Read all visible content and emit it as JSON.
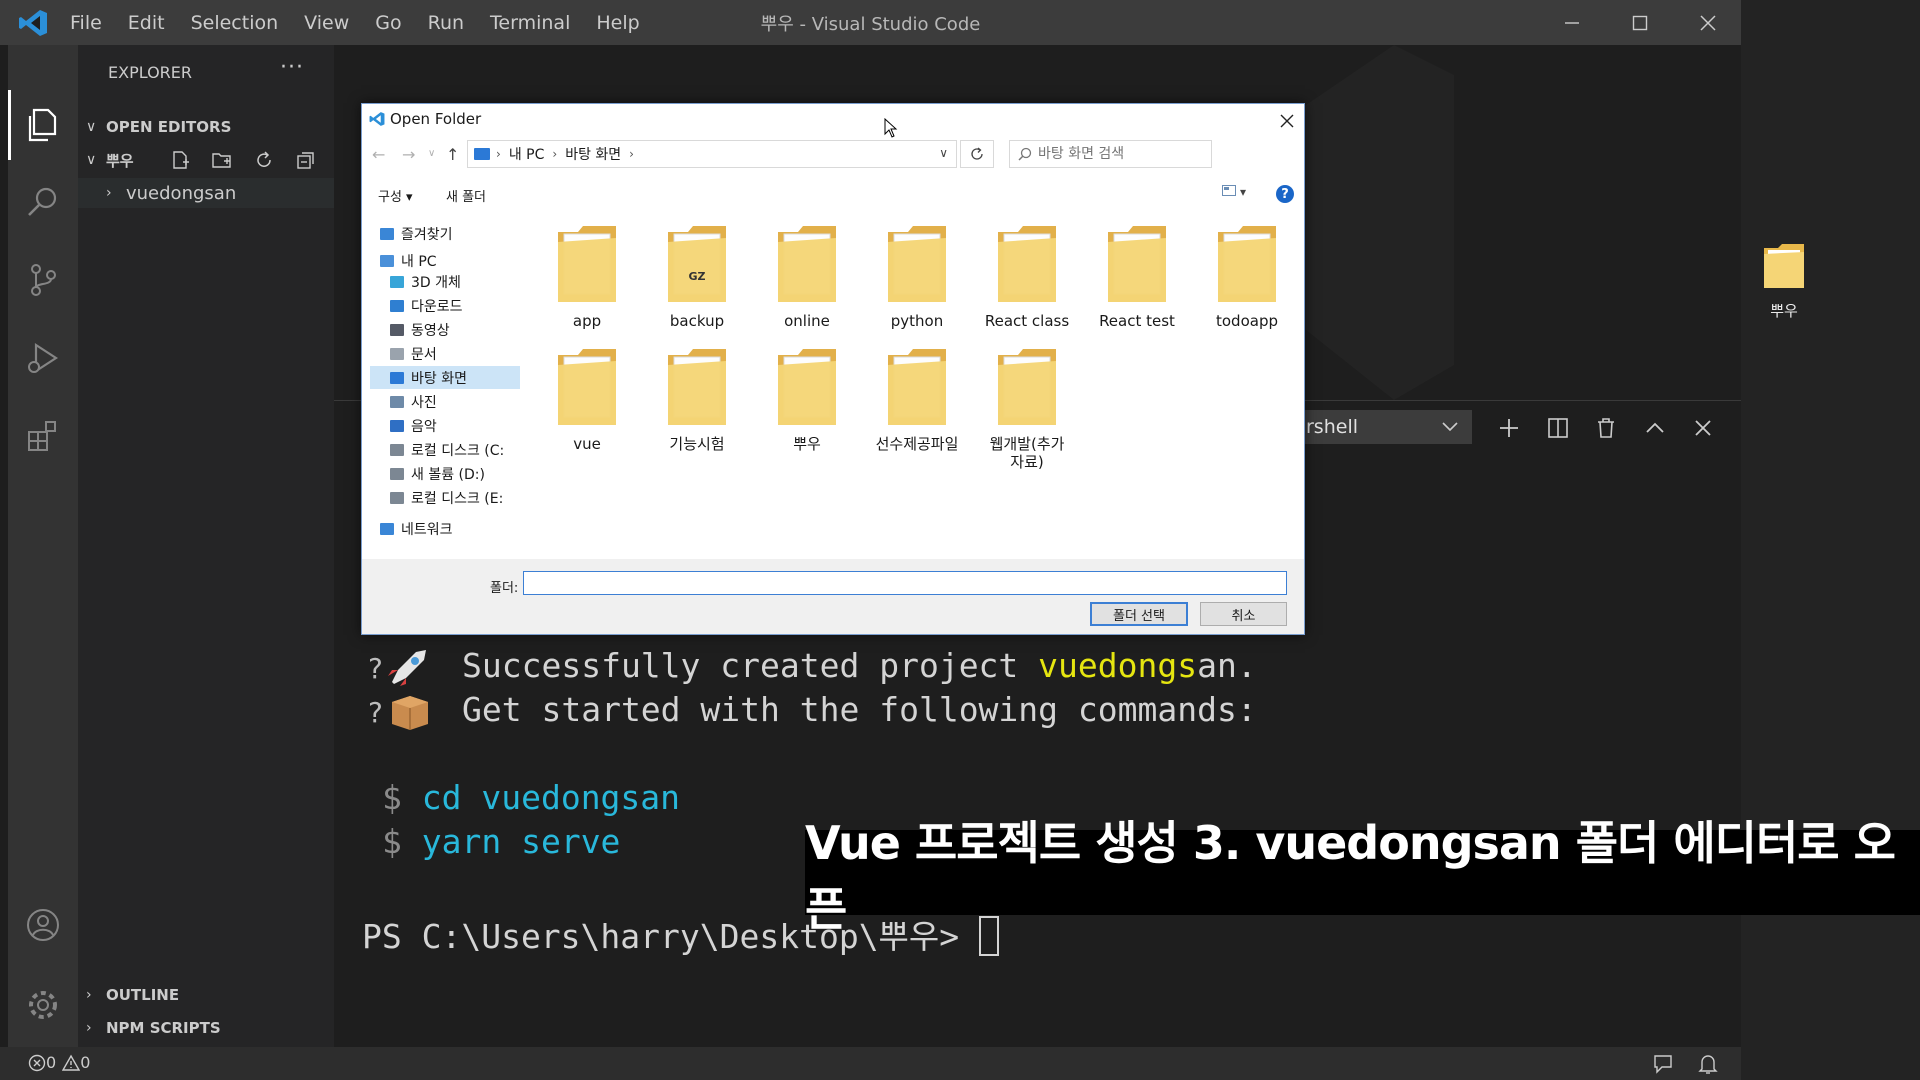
{
  "titlebar": {
    "menu": [
      "File",
      "Edit",
      "Selection",
      "View",
      "Go",
      "Run",
      "Terminal",
      "Help"
    ],
    "window_title": "뿌우 - Visual Studio Code"
  },
  "sidebar": {
    "title": "EXPLORER",
    "more": "···",
    "open_editors": "OPEN EDITORS",
    "folder": "뿌우",
    "tree_item": "vuedongsan",
    "outline": "OUTLINE",
    "npm_scripts": "NPM SCRIPTS"
  },
  "panel": {
    "shell_label": "rshell"
  },
  "terminal": {
    "line1_a": "Successfully created project ",
    "line1_b": "vuedongs",
    "line1_c": "an.",
    "line2": "Get started with the following commands:",
    "cmd_prompt": "$",
    "cmd1": "cd vuedongsan",
    "cmd2": "yarn serve",
    "ps_prompt": "PS C:\\Users\\harry\\Desktop\\뿌우>"
  },
  "statusbar": {
    "errors": "0",
    "warnings": "0"
  },
  "caption": "Vue 프로젝트 생성 3. vuedongsan 폴더 에디터로 오픈",
  "desktop": {
    "folder_label": "뿌우"
  },
  "dialog": {
    "title": "Open Folder",
    "breadcrumb": [
      "내 PC",
      "바탕 화면"
    ],
    "search_placeholder": "바탕 화면 검색",
    "toolbar": {
      "organize": "구성 ▾",
      "new_folder": "새 폴더",
      "help": "?"
    },
    "nav": [
      {
        "label": "즐겨찾기",
        "color": "#3a86d6"
      },
      {
        "label": "내 PC",
        "color": "#4a90d9"
      },
      {
        "label": "3D 개체",
        "color": "#38a5d8"
      },
      {
        "label": "다운로드",
        "color": "#2f7fd1"
      },
      {
        "label": "동영상",
        "color": "#555a66"
      },
      {
        "label": "문서",
        "color": "#9aa3ad"
      },
      {
        "label": "바탕 화면",
        "color": "#2b79d6"
      },
      {
        "label": "사진",
        "color": "#6e8aa8"
      },
      {
        "label": "음악",
        "color": "#2f6fc4"
      },
      {
        "label": "로컬 디스크 (C:",
        "color": "#7c8793"
      },
      {
        "label": "새 볼륨 (D:)",
        "color": "#7c8793"
      },
      {
        "label": "로컬 디스크 (E:",
        "color": "#7c8793"
      },
      {
        "label": "네트워크",
        "color": "#3a86d6"
      }
    ],
    "files": [
      {
        "name": "app",
        "badge": ""
      },
      {
        "name": "backup",
        "badge": "GZ"
      },
      {
        "name": "online",
        "badge": ""
      },
      {
        "name": "python",
        "badge": ""
      },
      {
        "name": "React class",
        "badge": ""
      },
      {
        "name": "React test",
        "badge": ""
      },
      {
        "name": "todoapp",
        "badge": ""
      },
      {
        "name": "vue",
        "badge": ""
      },
      {
        "name": "기능시험",
        "badge": ""
      },
      {
        "name": "뿌우",
        "badge": ""
      },
      {
        "name": "선수제공파일",
        "badge": ""
      },
      {
        "name": "웹개발(추가\n자료)",
        "badge": ""
      }
    ],
    "folder_label": "폴더:",
    "select_button": "폴더 선택",
    "cancel_button": "취소"
  },
  "colors": {
    "titlebar": "#3c3c3c",
    "activitybar": "#333333",
    "sidebar": "#252526",
    "editor": "#1e1e1e",
    "terminal_yellow": "#e5e510",
    "terminal_cyan": "#29b8db",
    "folder": "#f5d576"
  }
}
